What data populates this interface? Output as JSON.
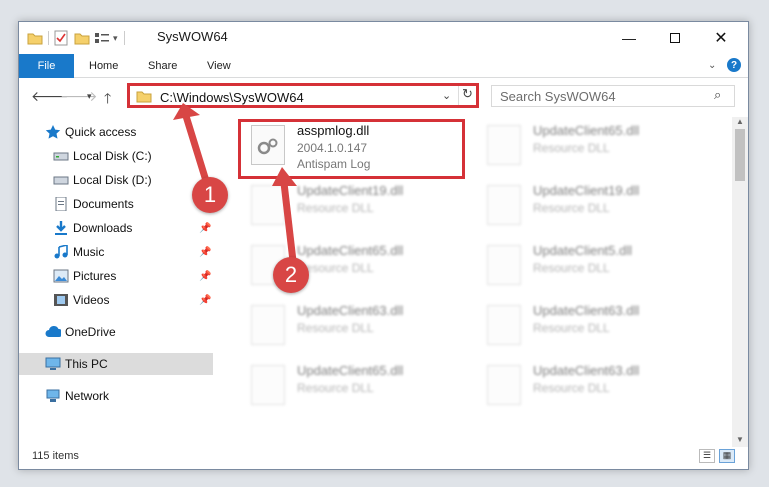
{
  "window": {
    "title": "SysWOW64"
  },
  "ribbon": {
    "tabs": [
      "File",
      "Home",
      "Share",
      "View"
    ]
  },
  "address": {
    "path": "C:\\Windows\\SysWOW64"
  },
  "search": {
    "placeholder": "Search SysWOW64"
  },
  "sidebar": {
    "items": [
      {
        "label": "Quick access",
        "icon": "star-icon"
      },
      {
        "label": "Local Disk (C:)",
        "icon": "drive-icon"
      },
      {
        "label": "Local Disk (D:)",
        "icon": "drive-icon"
      },
      {
        "label": "Documents",
        "icon": "documents-icon"
      },
      {
        "label": "Downloads",
        "icon": "download-icon",
        "pinned": true
      },
      {
        "label": "Music",
        "icon": "music-icon",
        "pinned": true
      },
      {
        "label": "Pictures",
        "icon": "pictures-icon",
        "pinned": true
      },
      {
        "label": "Videos",
        "icon": "videos-icon",
        "pinned": true
      },
      {
        "label": "OneDrive",
        "icon": "cloud-icon"
      },
      {
        "label": "This PC",
        "icon": "computer-icon",
        "selected": true
      },
      {
        "label": "Network",
        "icon": "network-icon"
      }
    ]
  },
  "files": [
    {
      "name": "asspmlog.dll",
      "line2": "2004.1.0.147",
      "line3": "Antispam Log",
      "highlighted": true
    },
    {
      "name": "UpdateClient65.dll",
      "line2": "Resource DLL"
    },
    {
      "name": "UpdateClient19.dll",
      "line2": "Resource DLL"
    },
    {
      "name": "UpdateClient19.dll",
      "line2": "Resource DLL"
    },
    {
      "name": "UpdateClient65.dll",
      "line2": "Resource DLL"
    },
    {
      "name": "UpdateClient5.dll",
      "line2": "Resource DLL"
    },
    {
      "name": "UpdateClient63.dll",
      "line2": "Resource DLL"
    },
    {
      "name": "UpdateClient63.dll",
      "line2": "Resource DLL"
    },
    {
      "name": "UpdateClient65.dll",
      "line2": "Resource DLL"
    },
    {
      "name": "UpdateClient63.dll",
      "line2": "Resource DLL"
    }
  ],
  "status": {
    "count": "115 items"
  },
  "annotations": {
    "badge1": "1",
    "badge2": "2",
    "color": "#d84645"
  }
}
